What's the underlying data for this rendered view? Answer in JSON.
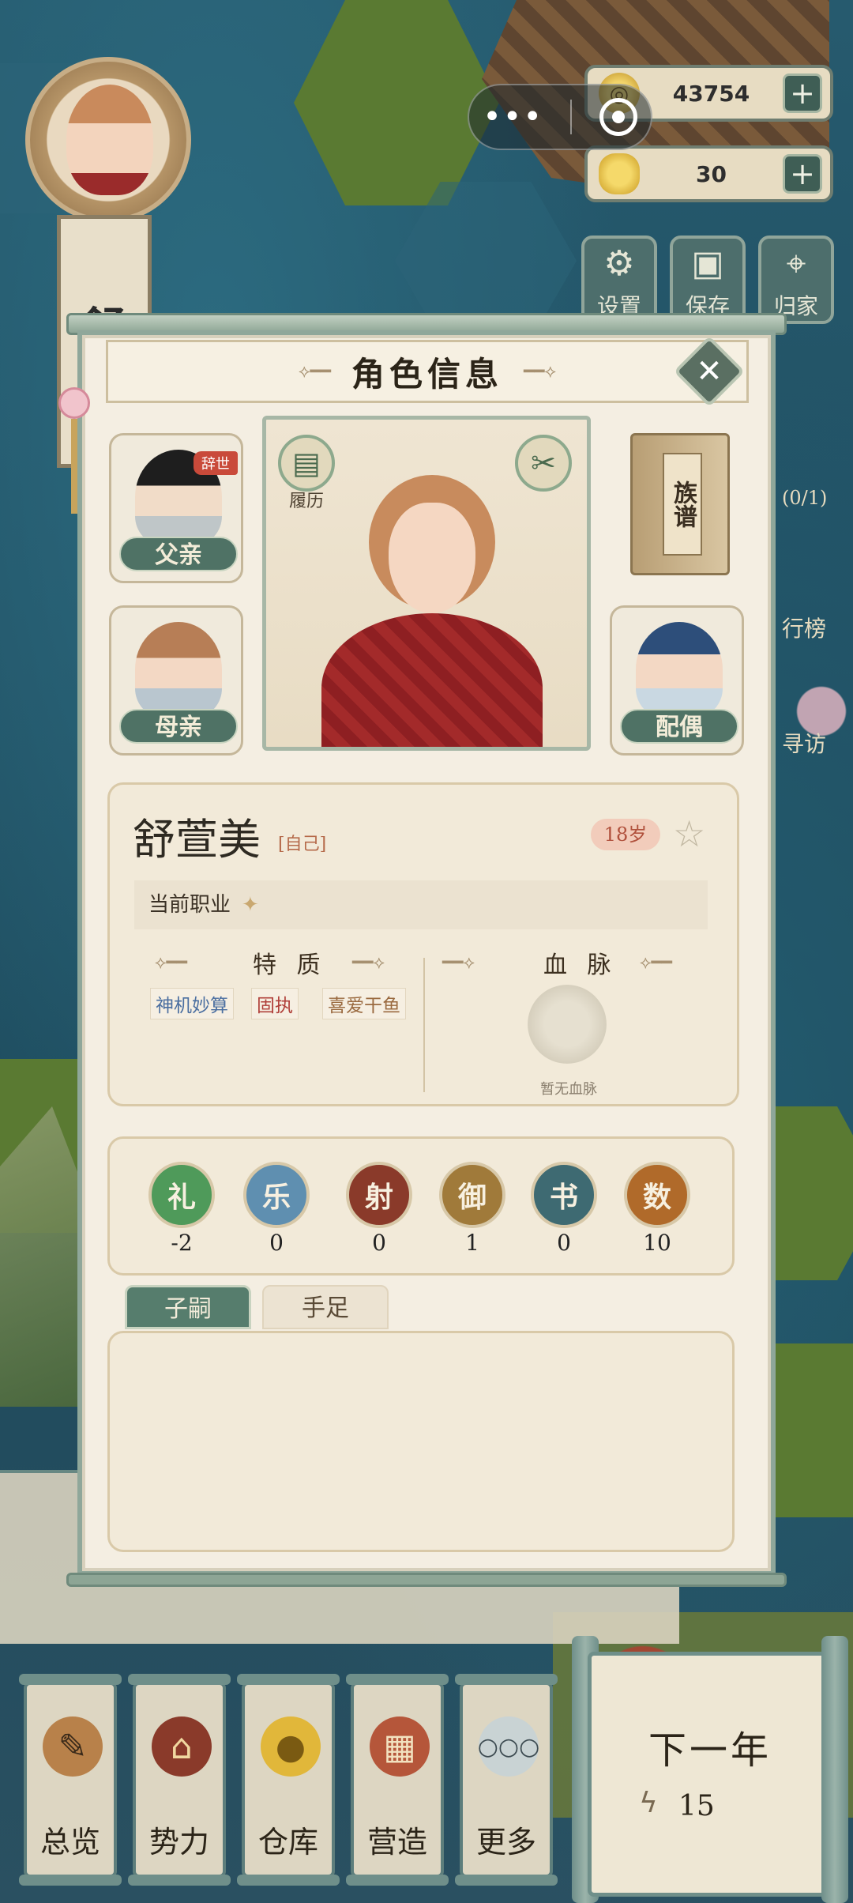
{
  "currency": {
    "coins": "43754",
    "ingots": "30",
    "plus": "+"
  },
  "capsule": {
    "more": "•••"
  },
  "tools": [
    {
      "label": "设置",
      "icon": "gear-icon"
    },
    {
      "label": "保存",
      "icon": "save-icon"
    },
    {
      "label": "归家",
      "icon": "location-pin-icon"
    }
  ],
  "side": {
    "quest": "(0/1)",
    "rank": "行榜",
    "visit": "寻访"
  },
  "banner": {
    "name": "舒乐"
  },
  "panel": {
    "title": "角色信息",
    "close": "✕",
    "relatives": {
      "father": {
        "label": "父亲",
        "tag": "辞世"
      },
      "mother": {
        "label": "母亲"
      },
      "spouse": {
        "label": "配偶"
      }
    },
    "resume_label": "履历",
    "clan_book": "族谱",
    "name": "舒萱美",
    "self_tag": "[自己]",
    "age": "18岁",
    "job_label": "当前职业",
    "traits_heading": "特 质",
    "traits": [
      "神机妙算",
      "固执",
      "喜爱干鱼"
    ],
    "blood_heading": "血 脉",
    "blood_empty": "暂无血脉",
    "arts": [
      {
        "name": "礼",
        "value": "-2",
        "color": "#4f9a5a"
      },
      {
        "name": "乐",
        "value": "0",
        "color": "#5f8fb0"
      },
      {
        "name": "射",
        "value": "0",
        "color": "#8a3a2a"
      },
      {
        "name": "御",
        "value": "1",
        "color": "#a07a3a"
      },
      {
        "name": "书",
        "value": "0",
        "color": "#3e6a72"
      },
      {
        "name": "数",
        "value": "10",
        "color": "#b06a2a"
      }
    ],
    "tabs": {
      "children": "子嗣",
      "siblings": "手足"
    }
  },
  "nav": [
    {
      "label": "总览",
      "icon": "brush-scroll-icon"
    },
    {
      "label": "势力",
      "icon": "palace-icon"
    },
    {
      "label": "仓库",
      "icon": "money-bag-icon"
    },
    {
      "label": "营造",
      "icon": "trowel-bricks-icon"
    },
    {
      "label": "更多",
      "icon": "more-dots-icon"
    }
  ],
  "next_year": {
    "label": "下一年",
    "energy": "15"
  }
}
